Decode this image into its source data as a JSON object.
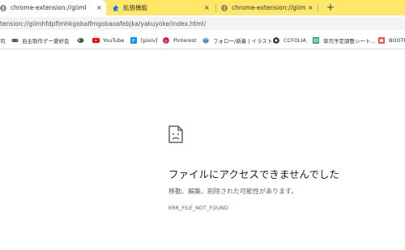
{
  "tabs": [
    {
      "title": "chrome-extension://giimhfdpfim",
      "icon": "globe-icon",
      "active": true
    },
    {
      "title": "拡張機能",
      "icon": "puzzle-icon",
      "active": false
    },
    {
      "title": "chrome-extension://giimhfdpfim",
      "icon": "globe-icon",
      "active": false
    }
  ],
  "tab_close_label": "×",
  "new_tab_label": "+",
  "address_bar": {
    "url": "tension://giimhfdpfimhkgobalfmgobaoafebjka/yakuyoke/index.html/"
  },
  "bookmarks": [
    {
      "label": "司",
      "icon": "none"
    },
    {
      "label": "自主制作ゲー愛好会",
      "icon": "gamepad-icon"
    },
    {
      "label": "",
      "icon": "pokeball-icon"
    },
    {
      "label": "YouTube",
      "icon": "youtube-icon"
    },
    {
      "label": "[pixiv]",
      "icon": "pixiv-icon"
    },
    {
      "label": "Pinterest",
      "icon": "pinterest-icon"
    },
    {
      "label": "フォロー/新着 | イラスト...",
      "icon": "cube-icon"
    },
    {
      "label": "CCFOLIA",
      "icon": "ccfolia-icon"
    },
    {
      "label": "草司予定調整シート...",
      "icon": "sheets-icon"
    },
    {
      "label": "BOOTH",
      "icon": "booth-icon"
    }
  ],
  "error": {
    "icon": "broken-file-icon",
    "heading": "ファイルにアクセスできませんでした",
    "description": "移動、編集、削除された可能性があります。",
    "code": "ERR_FILE_NOT_FOUND"
  },
  "colors": {
    "tabstrip": "#ffe869",
    "youtube": "#ff0000",
    "pixiv": "#0096fa",
    "pinterest": "#e60023",
    "sheets": "#0f9d58",
    "booth": "#fc4d50"
  }
}
